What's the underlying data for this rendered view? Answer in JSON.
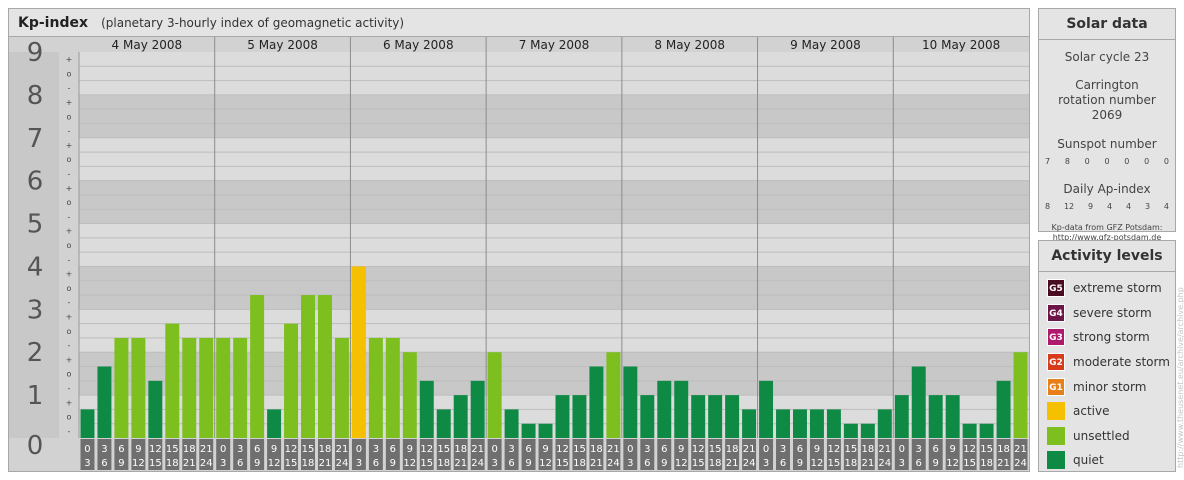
{
  "header": {
    "title": "Kp-index",
    "subtitle": "(planetary 3-hourly index of geomagnetic activity)"
  },
  "chart_data": {
    "type": "bar",
    "title": "Kp-index",
    "subtitle": "(planetary 3-hourly index of geomagnetic activity)",
    "ylim": [
      0,
      9
    ],
    "y_ticks": [
      "0",
      "1",
      "2",
      "3",
      "4",
      "5",
      "6",
      "7",
      "8",
      "9"
    ],
    "y_minor_marks": [
      "-",
      "o",
      "+"
    ],
    "days": [
      "4 May 2008",
      "5 May 2008",
      "6 May 2008",
      "7 May 2008",
      "8 May 2008",
      "9 May 2008",
      "10 May 2008"
    ],
    "interval_starts": [
      "0",
      "3",
      "6",
      "9",
      "12",
      "15",
      "18",
      "21"
    ],
    "interval_ends": [
      "3",
      "6",
      "9",
      "12",
      "15",
      "18",
      "21",
      "24"
    ],
    "values": [
      [
        0.667,
        1.667,
        2.333,
        2.333,
        1.333,
        2.667,
        2.333,
        2.333
      ],
      [
        2.333,
        2.333,
        3.333,
        0.667,
        2.667,
        3.333,
        3.333,
        2.333
      ],
      [
        4.0,
        2.333,
        2.333,
        2.0,
        1.333,
        0.667,
        1.0,
        1.333
      ],
      [
        2.0,
        0.667,
        0.333,
        0.333,
        1.0,
        1.0,
        1.667,
        2.0
      ],
      [
        1.667,
        1.0,
        1.333,
        1.333,
        1.0,
        1.0,
        1.0,
        0.667
      ],
      [
        1.333,
        0.667,
        0.667,
        0.667,
        0.667,
        0.333,
        0.333,
        0.667
      ],
      [
        1.0,
        1.667,
        1.0,
        1.0,
        0.333,
        0.333,
        1.333,
        2.0
      ]
    ],
    "level_colors": {
      "quiet": "#0f8a45",
      "unsettled": "#7cbf1f",
      "active": "#f5c000"
    },
    "grid": true
  },
  "solar": {
    "title": "Solar data",
    "cycle": "Solar cycle 23",
    "carrington": "Carrington rotation number 2069",
    "sunspot_label": "Sunspot number",
    "sunspot_values": [
      "7",
      "8",
      "0",
      "0",
      "0",
      "0",
      "0"
    ],
    "ap_label": "Daily Ap-index",
    "ap_values": [
      "8",
      "12",
      "9",
      "4",
      "4",
      "3",
      "4"
    ],
    "source_line1": "Kp-data from GFZ Potsdam:",
    "source_line2": "http://www.gfz-potsdam.de"
  },
  "activity": {
    "title": "Activity levels",
    "items": [
      {
        "code": "G5",
        "label": "extreme storm",
        "color": "#4a0c1f"
      },
      {
        "code": "G4",
        "label": "severe storm",
        "color": "#6c1547"
      },
      {
        "code": "G3",
        "label": "strong storm",
        "color": "#b01a6e"
      },
      {
        "code": "G2",
        "label": "moderate storm",
        "color": "#d63c1c"
      },
      {
        "code": "G1",
        "label": "minor storm",
        "color": "#e8801a"
      },
      {
        "code": "",
        "label": "active",
        "color": "#f5c000"
      },
      {
        "code": "",
        "label": "unsettled",
        "color": "#7cbf1f"
      },
      {
        "code": "",
        "label": "quiet",
        "color": "#0f8a45"
      }
    ]
  },
  "watermark": "http://www.theusenet.eu/archive/archive.php"
}
